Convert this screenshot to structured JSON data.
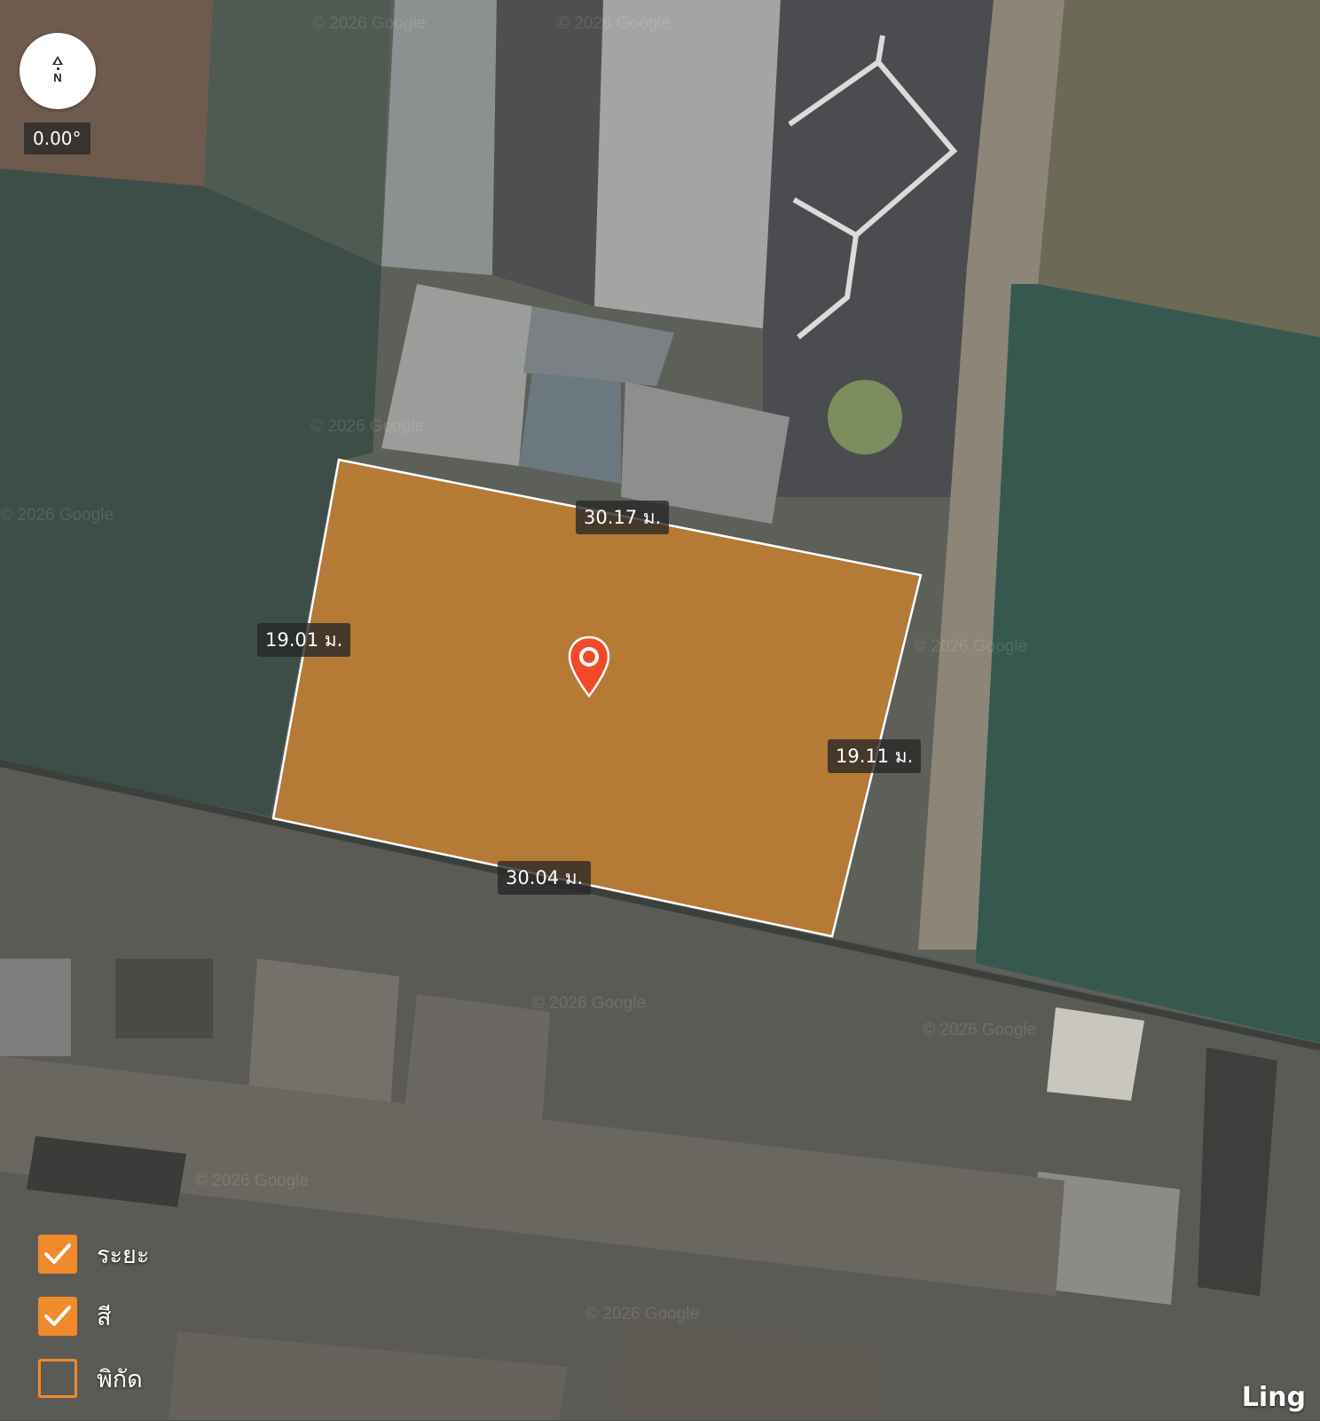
{
  "map": {
    "watermark": "© 2026 Google",
    "brand": "Ling"
  },
  "compass": {
    "letter": "N",
    "bearing": "0.00°"
  },
  "plot": {
    "fill_color": "#c8802e",
    "outline_color": "#ffffff",
    "dimensions": {
      "top": "30.17 ม.",
      "left": "19.01 ม.",
      "right": "19.11 ม.",
      "bottom": "30.04 ม."
    }
  },
  "pin": {
    "color": "#f04a2a"
  },
  "toggles": [
    {
      "label": "ระยะ",
      "checked": true
    },
    {
      "label": "สี",
      "checked": true
    },
    {
      "label": "พิกัด",
      "checked": false
    }
  ],
  "colors": {
    "accent": "#f08a2a"
  }
}
